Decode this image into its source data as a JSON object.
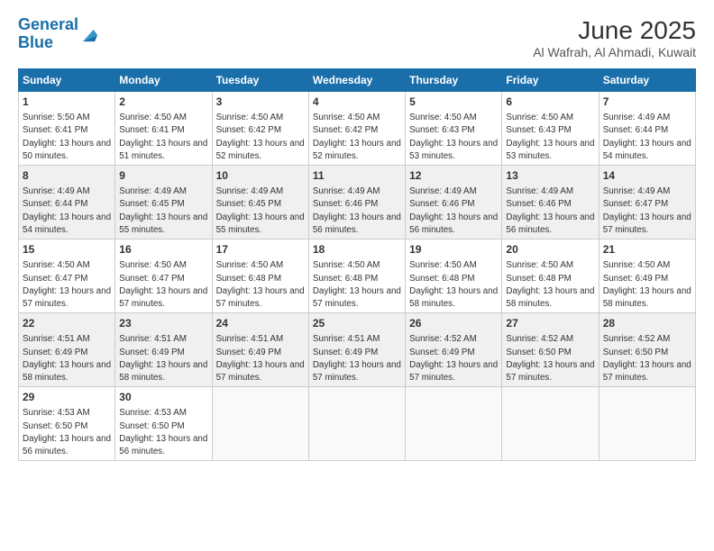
{
  "logo": {
    "line1": "General",
    "line2": "Blue"
  },
  "title": "June 2025",
  "location": "Al Wafrah, Al Ahmadi, Kuwait",
  "weekdays": [
    "Sunday",
    "Monday",
    "Tuesday",
    "Wednesday",
    "Thursday",
    "Friday",
    "Saturday"
  ],
  "weeks": [
    [
      {
        "day": "1",
        "sunrise": "5:50 AM",
        "sunset": "6:41 PM",
        "daylight": "13 hours and 50 minutes."
      },
      {
        "day": "2",
        "sunrise": "4:50 AM",
        "sunset": "6:41 PM",
        "daylight": "13 hours and 51 minutes."
      },
      {
        "day": "3",
        "sunrise": "4:50 AM",
        "sunset": "6:42 PM",
        "daylight": "13 hours and 52 minutes."
      },
      {
        "day": "4",
        "sunrise": "4:50 AM",
        "sunset": "6:42 PM",
        "daylight": "13 hours and 52 minutes."
      },
      {
        "day": "5",
        "sunrise": "4:50 AM",
        "sunset": "6:43 PM",
        "daylight": "13 hours and 53 minutes."
      },
      {
        "day": "6",
        "sunrise": "4:50 AM",
        "sunset": "6:43 PM",
        "daylight": "13 hours and 53 minutes."
      },
      {
        "day": "7",
        "sunrise": "4:49 AM",
        "sunset": "6:44 PM",
        "daylight": "13 hours and 54 minutes."
      }
    ],
    [
      {
        "day": "8",
        "sunrise": "4:49 AM",
        "sunset": "6:44 PM",
        "daylight": "13 hours and 54 minutes."
      },
      {
        "day": "9",
        "sunrise": "4:49 AM",
        "sunset": "6:45 PM",
        "daylight": "13 hours and 55 minutes."
      },
      {
        "day": "10",
        "sunrise": "4:49 AM",
        "sunset": "6:45 PM",
        "daylight": "13 hours and 55 minutes."
      },
      {
        "day": "11",
        "sunrise": "4:49 AM",
        "sunset": "6:46 PM",
        "daylight": "13 hours and 56 minutes."
      },
      {
        "day": "12",
        "sunrise": "4:49 AM",
        "sunset": "6:46 PM",
        "daylight": "13 hours and 56 minutes."
      },
      {
        "day": "13",
        "sunrise": "4:49 AM",
        "sunset": "6:46 PM",
        "daylight": "13 hours and 56 minutes."
      },
      {
        "day": "14",
        "sunrise": "4:49 AM",
        "sunset": "6:47 PM",
        "daylight": "13 hours and 57 minutes."
      }
    ],
    [
      {
        "day": "15",
        "sunrise": "4:50 AM",
        "sunset": "6:47 PM",
        "daylight": "13 hours and 57 minutes."
      },
      {
        "day": "16",
        "sunrise": "4:50 AM",
        "sunset": "6:47 PM",
        "daylight": "13 hours and 57 minutes."
      },
      {
        "day": "17",
        "sunrise": "4:50 AM",
        "sunset": "6:48 PM",
        "daylight": "13 hours and 57 minutes."
      },
      {
        "day": "18",
        "sunrise": "4:50 AM",
        "sunset": "6:48 PM",
        "daylight": "13 hours and 57 minutes."
      },
      {
        "day": "19",
        "sunrise": "4:50 AM",
        "sunset": "6:48 PM",
        "daylight": "13 hours and 58 minutes."
      },
      {
        "day": "20",
        "sunrise": "4:50 AM",
        "sunset": "6:48 PM",
        "daylight": "13 hours and 58 minutes."
      },
      {
        "day": "21",
        "sunrise": "4:50 AM",
        "sunset": "6:49 PM",
        "daylight": "13 hours and 58 minutes."
      }
    ],
    [
      {
        "day": "22",
        "sunrise": "4:51 AM",
        "sunset": "6:49 PM",
        "daylight": "13 hours and 58 minutes."
      },
      {
        "day": "23",
        "sunrise": "4:51 AM",
        "sunset": "6:49 PM",
        "daylight": "13 hours and 58 minutes."
      },
      {
        "day": "24",
        "sunrise": "4:51 AM",
        "sunset": "6:49 PM",
        "daylight": "13 hours and 57 minutes."
      },
      {
        "day": "25",
        "sunrise": "4:51 AM",
        "sunset": "6:49 PM",
        "daylight": "13 hours and 57 minutes."
      },
      {
        "day": "26",
        "sunrise": "4:52 AM",
        "sunset": "6:49 PM",
        "daylight": "13 hours and 57 minutes."
      },
      {
        "day": "27",
        "sunrise": "4:52 AM",
        "sunset": "6:50 PM",
        "daylight": "13 hours and 57 minutes."
      },
      {
        "day": "28",
        "sunrise": "4:52 AM",
        "sunset": "6:50 PM",
        "daylight": "13 hours and 57 minutes."
      }
    ],
    [
      {
        "day": "29",
        "sunrise": "4:53 AM",
        "sunset": "6:50 PM",
        "daylight": "13 hours and 56 minutes."
      },
      {
        "day": "30",
        "sunrise": "4:53 AM",
        "sunset": "6:50 PM",
        "daylight": "13 hours and 56 minutes."
      },
      null,
      null,
      null,
      null,
      null
    ]
  ]
}
